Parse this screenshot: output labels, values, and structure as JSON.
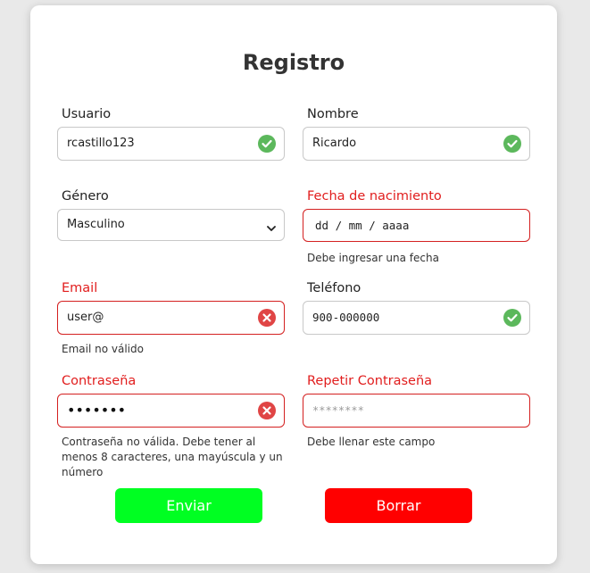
{
  "form": {
    "title": "Registro",
    "fields": {
      "usuario": {
        "label": "Usuario",
        "value": "rcastillo123",
        "status": "valid"
      },
      "nombre": {
        "label": "Nombre",
        "value": "Ricardo",
        "status": "valid"
      },
      "genero": {
        "label": "Género",
        "value": "Masculino"
      },
      "fecha": {
        "label": "Fecha de nacimiento",
        "value": "dd / mm / aaaa",
        "status": "invalid",
        "message": "Debe ingresar una fecha"
      },
      "email": {
        "label": "Email",
        "value": "user@",
        "status": "invalid",
        "message": "Email no válido"
      },
      "telefono": {
        "label": "Teléfono",
        "value": "900-000000",
        "status": "valid"
      },
      "contrasena": {
        "label": "Contraseña",
        "value": "•••••••",
        "status": "invalid",
        "message": "Contraseña no válida. Debe tener al menos 8 caracteres, una mayúscula y un número"
      },
      "repetir": {
        "label": "Repetir Contraseña",
        "placeholder": "********",
        "status": "invalid",
        "message": "Debe llenar este campo"
      }
    },
    "buttons": {
      "send": "Enviar",
      "clear": "Borrar"
    }
  },
  "colors": {
    "valid": "#5cb85c",
    "invalid": "#e04545",
    "error_text": "#e11d1d",
    "send_button": "#00ff22",
    "clear_button": "#ff0000"
  },
  "icons": {
    "valid": "check-circle-icon",
    "invalid": "x-circle-icon",
    "select": "chevron-down-icon"
  }
}
